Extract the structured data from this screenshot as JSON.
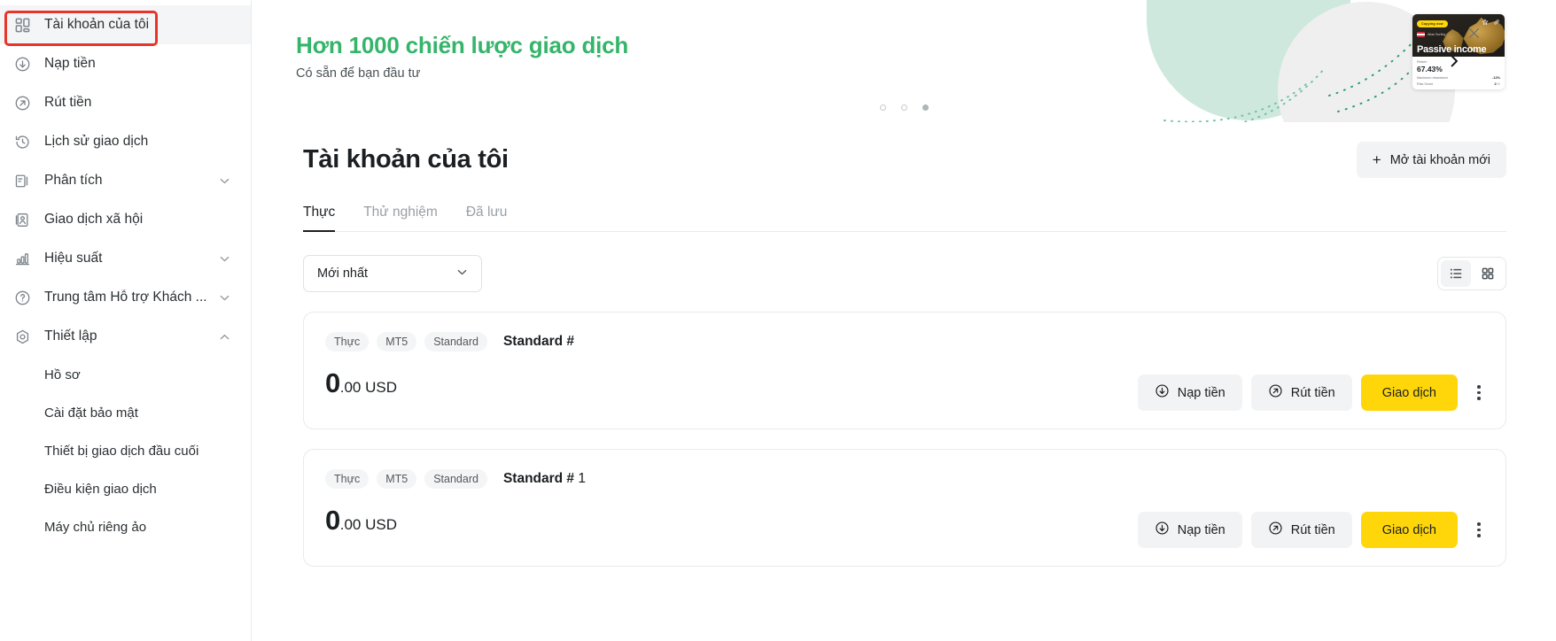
{
  "sidebar": {
    "items": [
      {
        "label": "Tài khoản của tôi",
        "icon": "grid-icon",
        "active": true,
        "expandable": false
      },
      {
        "label": "Nạp tiền",
        "icon": "arrow-down-circle-icon",
        "active": false,
        "expandable": false
      },
      {
        "label": "Rút tiền",
        "icon": "arrow-up-right-circle-icon",
        "active": false,
        "expandable": false
      },
      {
        "label": "Lịch sử giao dịch",
        "icon": "history-icon",
        "active": false,
        "expandable": false
      },
      {
        "label": "Phân tích",
        "icon": "analytics-icon",
        "active": false,
        "expandable": true,
        "expanded": false
      },
      {
        "label": "Giao dịch xã hội",
        "icon": "social-trading-icon",
        "active": false,
        "expandable": false
      },
      {
        "label": "Hiệu suất",
        "icon": "bar-chart-icon",
        "active": false,
        "expandable": true,
        "expanded": false
      },
      {
        "label": "Trung tâm Hỗ trợ Khách ...",
        "icon": "question-circle-icon",
        "active": false,
        "expandable": true,
        "expanded": false
      },
      {
        "label": "Thiết lập",
        "icon": "gear-icon",
        "active": false,
        "expandable": true,
        "expanded": true
      }
    ],
    "settings_children": [
      {
        "label": "Hồ sơ"
      },
      {
        "label": "Cài đặt bảo mật"
      },
      {
        "label": "Thiết bị giao dịch đầu cuối"
      },
      {
        "label": "Điều kiện giao dịch"
      },
      {
        "label": "Máy chủ riêng ảo"
      }
    ]
  },
  "banner": {
    "title": "Hơn 1000 chiến lược giao dịch",
    "subtitle": "Có sẵn để bạn đầu tư",
    "close_icon": "close-icon",
    "next_icon": "chevron-right-icon",
    "dots": [
      false,
      false,
      true
    ],
    "accent_color": "#34b56a",
    "card": {
      "badge": "Copying now",
      "flag_label": "Atlas Surfing",
      "name": "Passive income",
      "return_label": "Return",
      "return_value": "67.43%",
      "drawdown_label": "Maximum drawdown",
      "drawdown_value": "-12%",
      "risk_label": "Risk Score",
      "risk_value": "2",
      "risk_total": "/10",
      "star_icon": "star-icon",
      "link_icon": "link-icon"
    }
  },
  "page": {
    "title": "Tài khoản của tôi",
    "open_account_button": "Mở tài khoản mới",
    "open_account_icon": "plus-icon",
    "tabs": [
      {
        "label": "Thực",
        "active": true
      },
      {
        "label": "Thử nghiệm",
        "active": false
      },
      {
        "label": "Đã lưu",
        "active": false
      }
    ],
    "sort_select": {
      "value": "Mới nhất",
      "chevron_icon": "chevron-down-icon"
    },
    "view_toggle": [
      {
        "icon": "list-view-icon",
        "active": true
      },
      {
        "icon": "grid-view-icon",
        "active": false
      }
    ]
  },
  "accounts": [
    {
      "chips": [
        "Thực",
        "MT5",
        "Standard"
      ],
      "name": "Standard #",
      "name_suffix": "",
      "balance_major": "0",
      "balance_minor": ".00 USD",
      "actions": [
        {
          "label": "Nạp tiền",
          "icon": "arrow-down-circle-icon",
          "style": "default"
        },
        {
          "label": "Rút tiền",
          "icon": "arrow-up-right-circle-icon",
          "style": "default"
        },
        {
          "label": "Giao dịch",
          "icon": "",
          "style": "primary"
        }
      ],
      "menu_icon": "kebab-menu-icon"
    },
    {
      "chips": [
        "Thực",
        "MT5",
        "Standard"
      ],
      "name": "Standard #",
      "name_suffix": " 1",
      "balance_major": "0",
      "balance_minor": ".00 USD",
      "actions": [
        {
          "label": "Nạp tiền",
          "icon": "arrow-down-circle-icon",
          "style": "default"
        },
        {
          "label": "Rút tiền",
          "icon": "arrow-up-right-circle-icon",
          "style": "default"
        },
        {
          "label": "Giao dịch",
          "icon": "",
          "style": "primary"
        }
      ],
      "menu_icon": "kebab-menu-icon"
    }
  ],
  "colors": {
    "primary_yellow": "#ffd60a",
    "accent_green": "#34b56a",
    "annotation_red": "#e8342a",
    "chip_grey": "#f4f5f6"
  }
}
